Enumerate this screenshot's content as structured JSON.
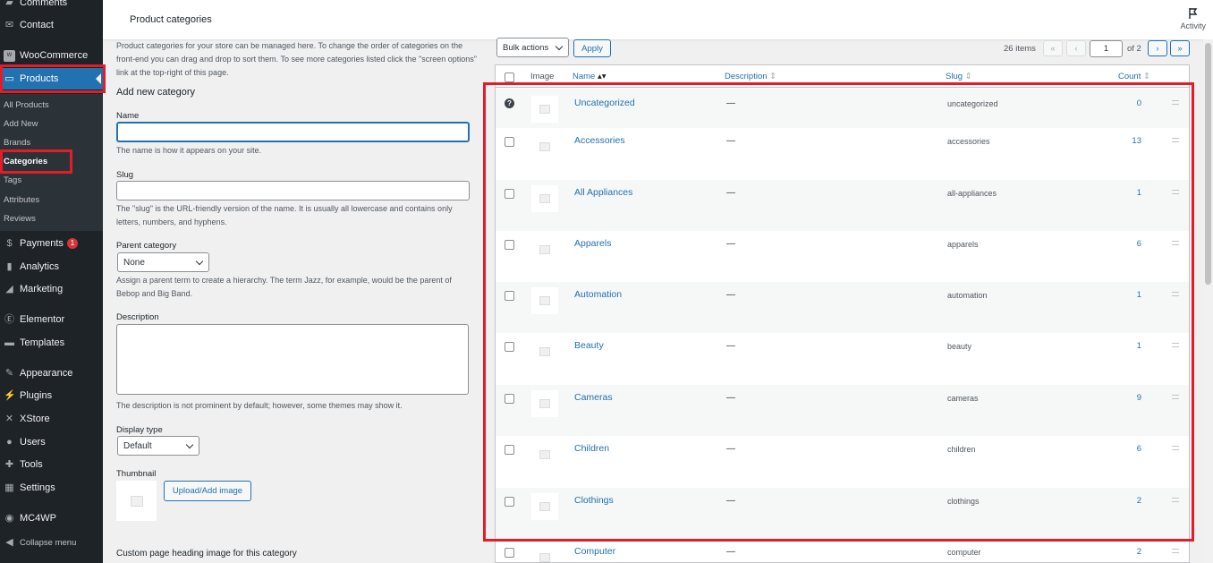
{
  "sidebar": {
    "comments": "Comments",
    "contact": "Contact",
    "woocommerce": "WooCommerce",
    "products": "Products",
    "sub": [
      "All Products",
      "Add New",
      "Brands",
      "Categories",
      "Tags",
      "Attributes",
      "Reviews"
    ],
    "payments": "Payments",
    "payments_badge": "1",
    "analytics": "Analytics",
    "marketing": "Marketing",
    "elementor": "Elementor",
    "templates": "Templates",
    "appearance": "Appearance",
    "plugins": "Plugins",
    "xstore": "XStore",
    "users": "Users",
    "tools": "Tools",
    "settings": "Settings",
    "mc4wp": "MC4WP",
    "collapse": "Collapse menu"
  },
  "header": {
    "title": "Product categories",
    "activity": "Activity"
  },
  "form": {
    "intro": "Product categories for your store can be managed here. To change the order of categories on the front-end you can drag and drop to sort them. To see more categories listed click the \"screen options\" link at the top-right of this page.",
    "heading": "Add new category",
    "name_label": "Name",
    "name_value": "",
    "name_help": "The name is how it appears on your site.",
    "slug_label": "Slug",
    "slug_value": "",
    "slug_help": "The \"slug\" is the URL-friendly version of the name. It is usually all lowercase and contains only letters, numbers, and hyphens.",
    "parent_label": "Parent category",
    "parent_value": "None",
    "parent_help": "Assign a parent term to create a hierarchy. The term Jazz, for example, would be the parent of Bebop and Big Band.",
    "desc_label": "Description",
    "desc_value": "",
    "desc_help": "The description is not prominent by default; however, some themes may show it.",
    "display_label": "Display type",
    "display_value": "Default",
    "thumb_label": "Thumbnail",
    "upload_btn": "Upload/Add image",
    "custom_heading": "Custom page heading image for this category"
  },
  "toolbar": {
    "bulk_actions": "Bulk actions",
    "apply": "Apply",
    "items": "26 items",
    "first": "«",
    "prev": "‹",
    "page": "1",
    "of": "of 2",
    "next": "›",
    "last": "»"
  },
  "table": {
    "headers": {
      "image": "Image",
      "name": "Name",
      "description": "Description",
      "slug": "Slug",
      "count": "Count"
    },
    "rows": [
      {
        "name": "Uncategorized",
        "description": "—",
        "slug": "uncategorized",
        "count": "0"
      },
      {
        "name": "Accessories",
        "description": "—",
        "slug": "accessories",
        "count": "13"
      },
      {
        "name": "All Appliances",
        "description": "—",
        "slug": "all-appliances",
        "count": "1"
      },
      {
        "name": "Apparels",
        "description": "—",
        "slug": "apparels",
        "count": "6"
      },
      {
        "name": "Automation",
        "description": "—",
        "slug": "automation",
        "count": "1"
      },
      {
        "name": "Beauty",
        "description": "—",
        "slug": "beauty",
        "count": "1"
      },
      {
        "name": "Cameras",
        "description": "—",
        "slug": "cameras",
        "count": "9"
      },
      {
        "name": "Children",
        "description": "—",
        "slug": "children",
        "count": "6"
      },
      {
        "name": "Clothings",
        "description": "—",
        "slug": "clothings",
        "count": "2"
      },
      {
        "name": "Computer",
        "description": "—",
        "slug": "computer",
        "count": "2"
      }
    ]
  },
  "colors": {
    "accent": "#2271b1",
    "sidebar": "#1d2327",
    "highlight": "#e11d2a"
  }
}
